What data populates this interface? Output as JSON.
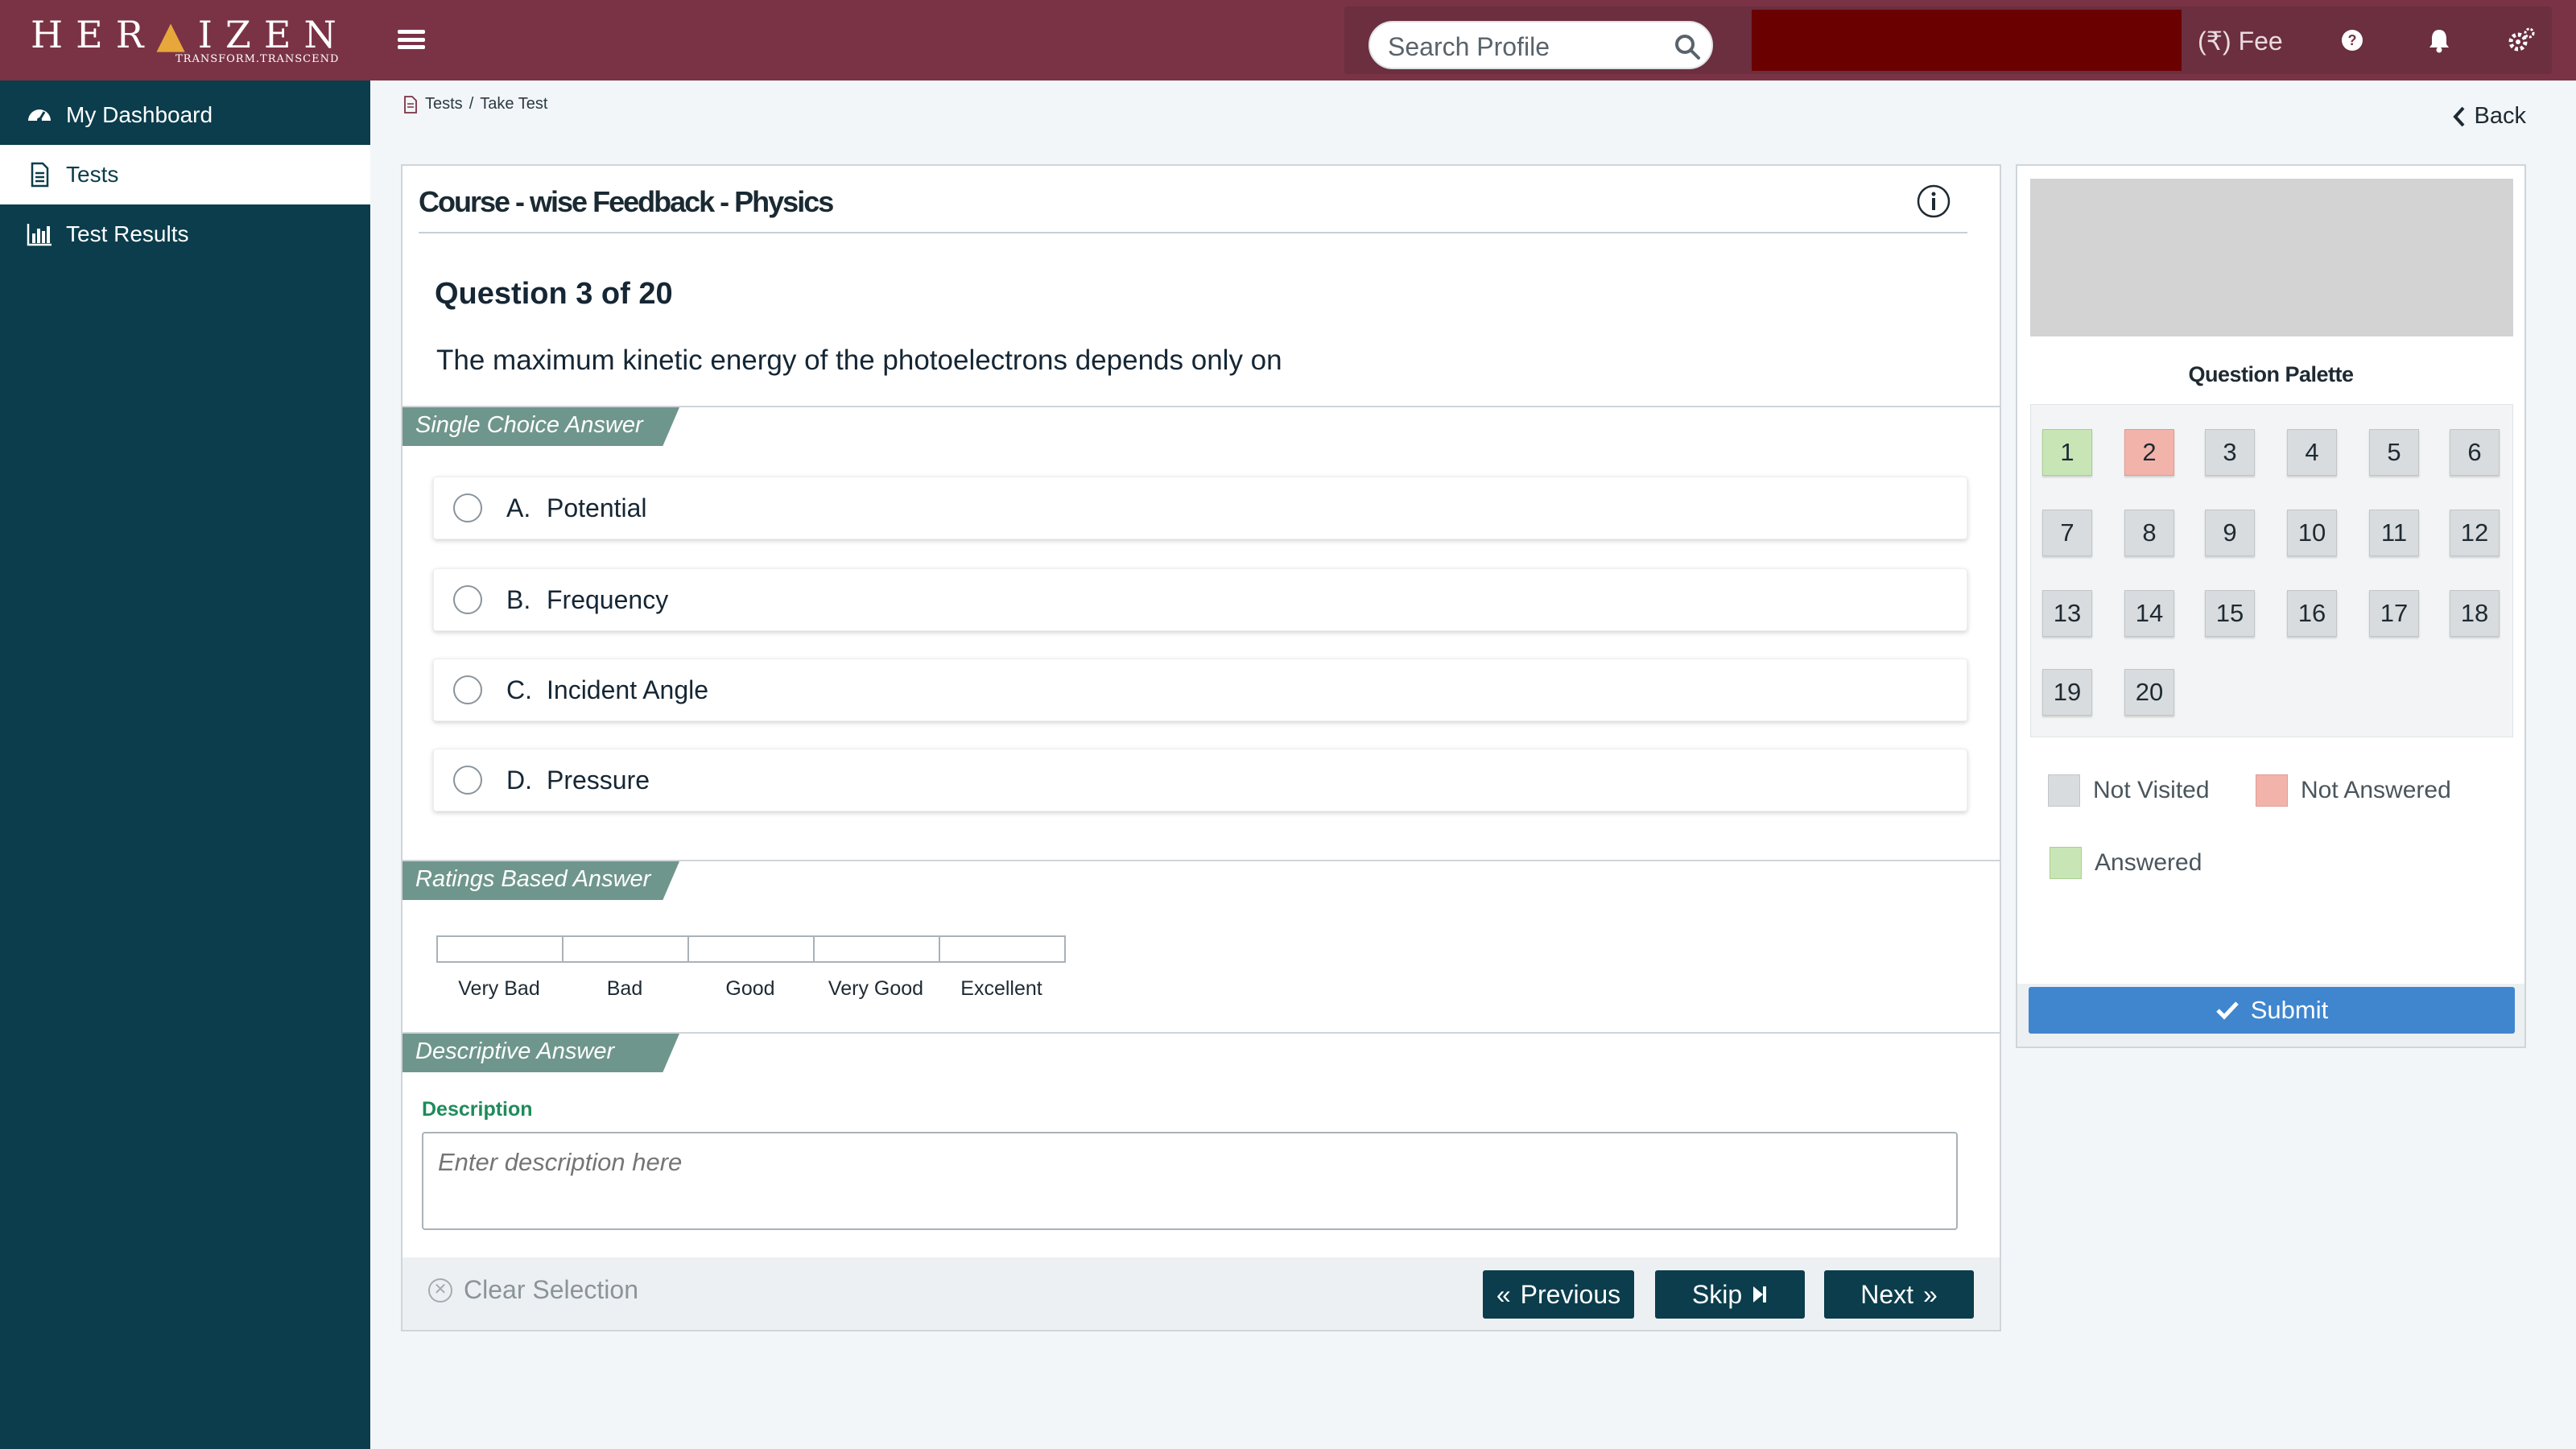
{
  "header": {
    "logo_main": "HERAIZEN",
    "logo_tagline": "TRANSFORM.TRANSCEND",
    "search_placeholder": "Search Profile",
    "fee_label": "(₹)  Fee"
  },
  "sidebar": {
    "items": [
      {
        "label": "My Dashboard",
        "icon": "dashboard-icon",
        "active": false
      },
      {
        "label": "Tests",
        "icon": "document-icon",
        "active": true
      },
      {
        "label": "Test Results",
        "icon": "bar-chart-icon",
        "active": false
      }
    ]
  },
  "breadcrumb": {
    "parent": "Tests",
    "separator": "/",
    "current": "Take Test"
  },
  "back_label": "Back",
  "test": {
    "title": "Course - wise Feedback - Physics",
    "question_number": "Question 3 of 20",
    "question_text": "The maximum kinetic energy of the photoelectrons depends only on",
    "sections": {
      "single_choice": "Single Choice Answer",
      "ratings": "Ratings Based Answer",
      "descriptive": "Descriptive Answer"
    },
    "options": [
      {
        "letter": "A.",
        "text": "Potential"
      },
      {
        "letter": "B.",
        "text": "Frequency"
      },
      {
        "letter": "C.",
        "text": "Incident Angle"
      },
      {
        "letter": "D.",
        "text": "Pressure"
      }
    ],
    "ratings": [
      "Very Bad",
      "Bad",
      "Good",
      "Very Good",
      "Excellent"
    ],
    "description_label": "Description",
    "description_placeholder": "Enter description here",
    "footer": {
      "clear_selection": "Clear Selection",
      "previous": "Previous",
      "skip": "Skip",
      "next": "Next"
    }
  },
  "palette": {
    "title": "Question Palette",
    "questions": [
      {
        "n": "1",
        "status": "answered"
      },
      {
        "n": "2",
        "status": "not-answered"
      },
      {
        "n": "3",
        "status": "not-visited"
      },
      {
        "n": "4",
        "status": "not-visited"
      },
      {
        "n": "5",
        "status": "not-visited"
      },
      {
        "n": "6",
        "status": "not-visited"
      },
      {
        "n": "7",
        "status": "not-visited"
      },
      {
        "n": "8",
        "status": "not-visited"
      },
      {
        "n": "9",
        "status": "not-visited"
      },
      {
        "n": "10",
        "status": "not-visited"
      },
      {
        "n": "11",
        "status": "not-visited"
      },
      {
        "n": "12",
        "status": "not-visited"
      },
      {
        "n": "13",
        "status": "not-visited"
      },
      {
        "n": "14",
        "status": "not-visited"
      },
      {
        "n": "15",
        "status": "not-visited"
      },
      {
        "n": "16",
        "status": "not-visited"
      },
      {
        "n": "17",
        "status": "not-visited"
      },
      {
        "n": "18",
        "status": "not-visited"
      },
      {
        "n": "19",
        "status": "not-visited"
      },
      {
        "n": "20",
        "status": "not-visited"
      }
    ],
    "legend": {
      "not_visited": "Not Visited",
      "not_answered": "Not Answered",
      "answered": "Answered"
    },
    "submit_label": "Submit"
  },
  "colors": {
    "topbar": "#7a3345",
    "sidebar": "#0b3d4c",
    "section_tag": "#6f968c",
    "answered": "#c8e6b5",
    "not_answered": "#f2b3ab",
    "not_visited": "#d9dcde",
    "submit": "#3f86cf"
  }
}
